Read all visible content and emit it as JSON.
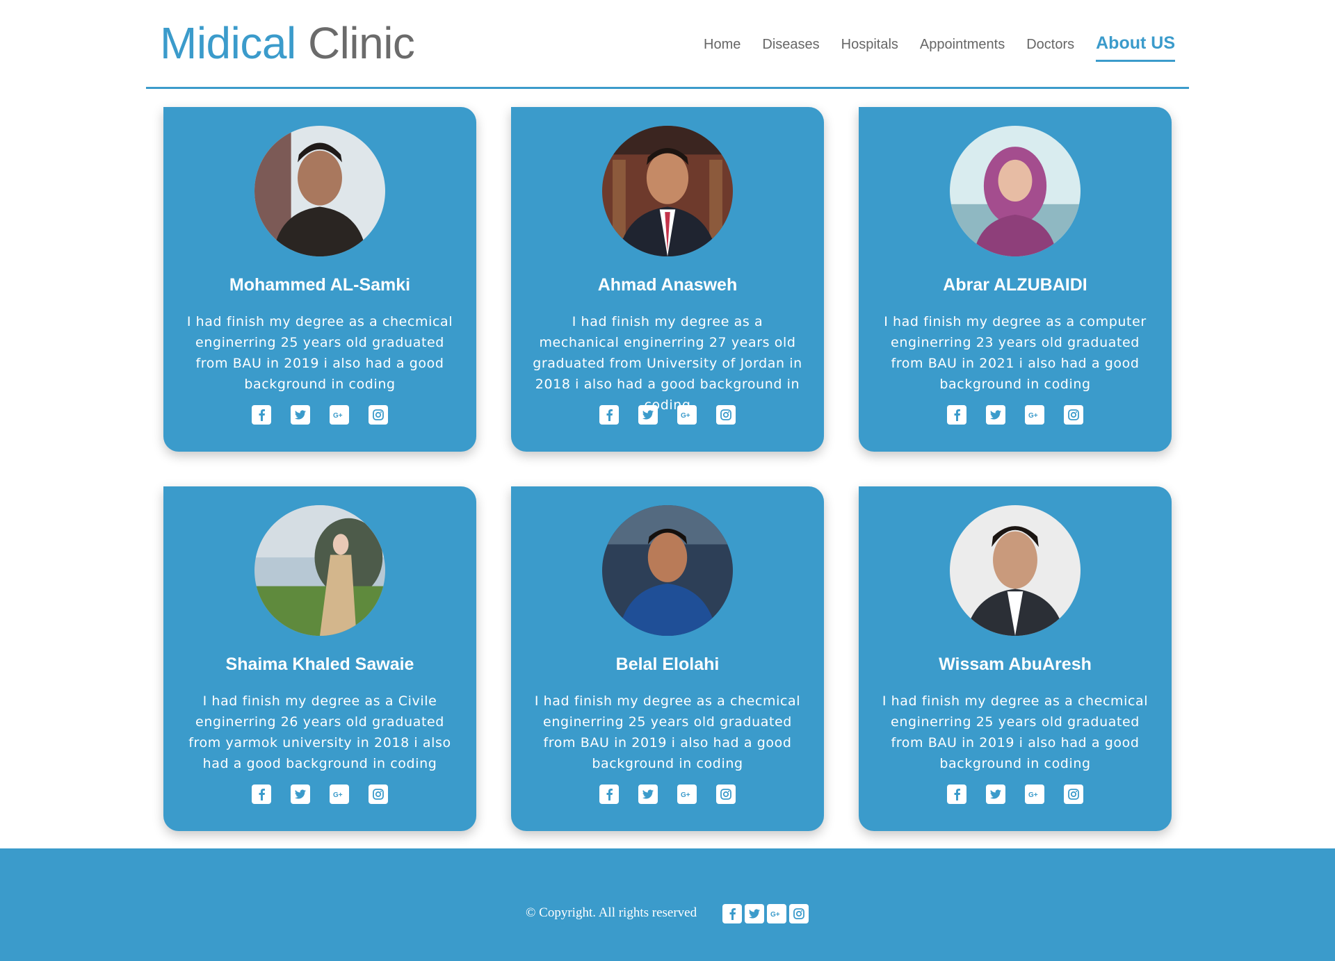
{
  "brand": {
    "part1": "Midical",
    "part2": "Clinic"
  },
  "nav": [
    "Home",
    "Diseases",
    "Hospitals",
    "Appointments",
    "Doctors",
    "About US"
  ],
  "nav_active": "About US",
  "colors": {
    "accent": "#3b9bcb",
    "text_gray": "#666666",
    "card_text": "#ffffff"
  },
  "social_icons": [
    "facebook-icon",
    "twitter-icon",
    "google-plus-icon",
    "instagram-icon"
  ],
  "cards": [
    {
      "name": "Mohammed AL-Samki",
      "bio": "I had finish my degree as a checmical enginerring 25 years old graduated from BAU in 2019 i also had a good background in coding"
    },
    {
      "name": "Ahmad Anasweh",
      "bio": "I had finish my degree as a mechanical enginerring 27 years old graduated from University of Jordan in 2018 i also had a good background in coding"
    },
    {
      "name": "Abrar ALZUBAIDI",
      "bio": "I had finish my degree as a computer enginerring 23 years old graduated from BAU in 2021 i also had a good background in coding"
    },
    {
      "name": "Shaima Khaled Sawaie",
      "bio": "I had finish my degree as a Civile enginerring 26 years old graduated from yarmok university in 2018 i also had a good background in coding"
    },
    {
      "name": "Belal Elolahi",
      "bio": "I had finish my degree as a checmical enginerring 25 years old graduated from BAU in 2019 i also had a good background in coding"
    },
    {
      "name": "Wissam AbuAresh",
      "bio": "I had finish my degree as a checmical enginerring 25 years old graduated from BAU in 2019 i also had a good background in coding"
    }
  ],
  "footer": {
    "copyright": "© Copyright. All rights reserved"
  }
}
